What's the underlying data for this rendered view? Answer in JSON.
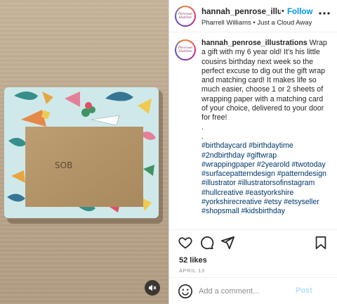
{
  "post": {
    "image_alt": "",
    "sticker_text": "SOB",
    "mute_icon": "speaker-muted-icon"
  },
  "header": {
    "username": "hannah_penrose_illustra",
    "separator": "•",
    "follow_label": "Follow",
    "audio": "Pharrell Williams • Just a Cloud Away",
    "avatar_logo": "Penrose Hatline",
    "more_icon": "more-horizontal-icon"
  },
  "caption": {
    "username": "hannah_penrose_illustrations",
    "body": "Wrap a gift with my 6 year old! It’s his little cousins birthday next week so the perfect excuse to dig out the gift wrap and matching card! It makes life so much easier, choose 1 or 2 sheets of wrapping paper with a matching card of your choice, delivered to your door for free!",
    "dot1": ".",
    "dot2": ".",
    "hashtags": "#birthdaycard #birthdaytime #2ndbirthday #giftwrap #wrappingpaper #2yearold #twotoday #surfacepatterndesign #patterndesign #illustrator #illustratorsofinstagram #hullcreative #eastyorkshire #yorkshirecreative #etsy #etsyseller #shopsmall #kidsbirthday"
  },
  "actions": {
    "like_icon": "heart-icon",
    "comment_icon": "comment-icon",
    "share_icon": "send-icon",
    "save_icon": "bookmark-icon"
  },
  "likes": "52 likes",
  "date": "APRIL 13",
  "comment": {
    "placeholder": "Add a comment...",
    "post_label": "Post",
    "emoji_icon": "smiley-icon"
  },
  "colors": {
    "accent": "#0095f6",
    "post_disabled": "#b2dffc",
    "hashtag": "#00376b",
    "wrap_paper": "#cfe9ea",
    "envelope": "#b6966a"
  }
}
